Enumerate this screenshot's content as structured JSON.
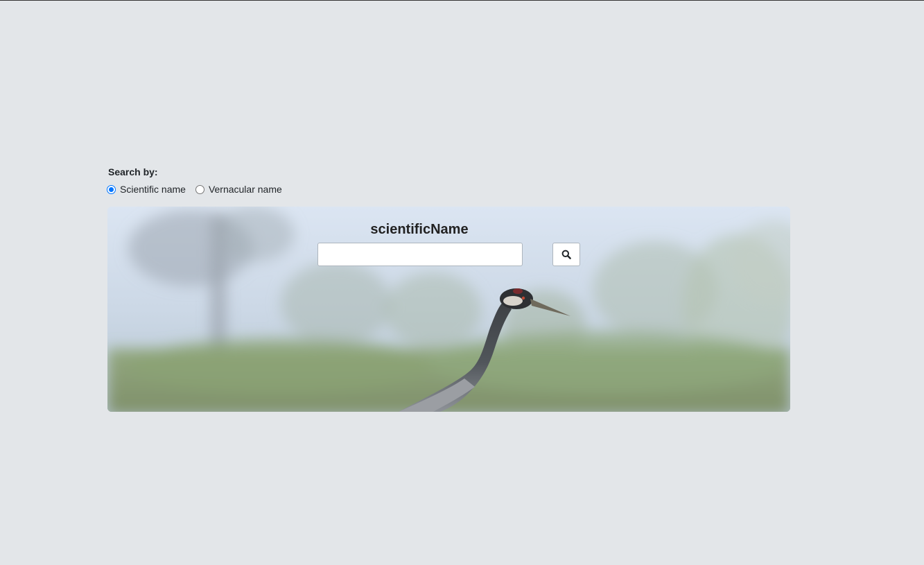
{
  "search": {
    "by_label": "Search by:",
    "options": [
      {
        "label": "Scientific name",
        "checked": true
      },
      {
        "label": "Vernacular name",
        "checked": false
      }
    ],
    "field_title": "scientificName",
    "input_value": "",
    "input_placeholder": "",
    "button_icon": "search-icon"
  },
  "banner": {
    "image": "crane-photo"
  },
  "colors": {
    "page_background": "#e3e6e9",
    "radio_accent": "#0075ff"
  }
}
